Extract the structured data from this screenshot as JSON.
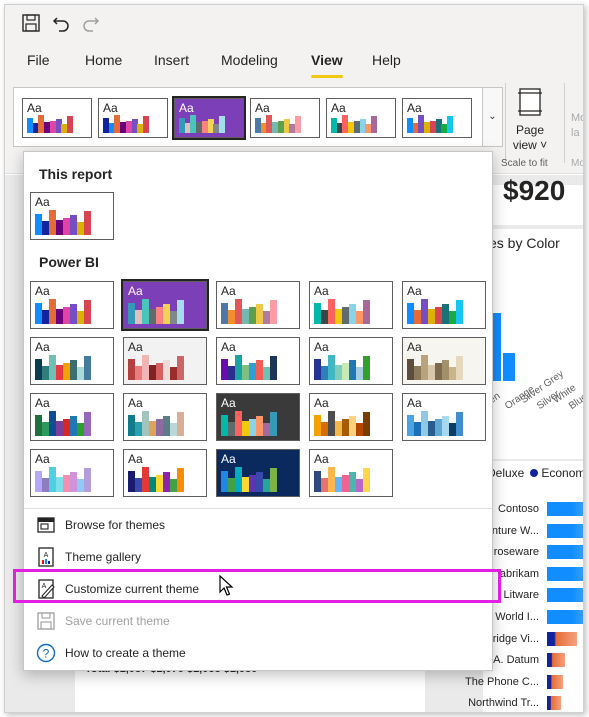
{
  "menubar": {
    "items": [
      "File",
      "Home",
      "Insert",
      "Modeling",
      "View",
      "Help"
    ],
    "active": "View"
  },
  "ribbon": {
    "page_view_label_1": "Page",
    "page_view_label_2": "view ˅",
    "scale_label": "Scale to fit",
    "cut_label_1": "Mo",
    "cut_label_2": "la",
    "cut_label_3": "Mo"
  },
  "themes": {
    "aa": "Aa",
    "this_report_title": "This report",
    "power_bi_title": "Power BI",
    "ribbon_palettes": [
      {
        "bg": "#ffffff",
        "colors": [
          "#118dff",
          "#12239e",
          "#e66c37",
          "#6b007b",
          "#e044a7",
          "#744ec2",
          "#d9b300",
          "#d64550"
        ]
      },
      {
        "bg": "#ffffff",
        "colors": [
          "#12239e",
          "#118dff",
          "#e66c37",
          "#6b007b",
          "#e044a7",
          "#744ec2",
          "#d9b300",
          "#d64550"
        ]
      },
      {
        "bg": "#7d3fb8",
        "colors": [
          "#3599b8",
          "#dfbfbf",
          "#4ac5bb",
          "#5f6b6d",
          "#fb8281",
          "#f4d25a",
          "#7f898a",
          "#a4ddee"
        ]
      },
      {
        "bg": "#ffffff",
        "colors": [
          "#4e79a7",
          "#f28e2b",
          "#e15759",
          "#76b7b2",
          "#59a14f",
          "#edc948",
          "#b07aa1",
          "#ff9da7"
        ]
      },
      {
        "bg": "#ffffff",
        "colors": [
          "#01b8aa",
          "#374649",
          "#fd625e",
          "#f2c80f",
          "#5f6b6d",
          "#8ad4eb",
          "#fe9666",
          "#a66999"
        ]
      },
      {
        "bg": "#ffffff",
        "colors": [
          "#118dff",
          "#e66c37",
          "#744ec2",
          "#d9b300",
          "#d64550",
          "#197278",
          "#1aab40",
          "#15c6f4"
        ]
      }
    ],
    "this_report": {
      "bg": "#ffffff",
      "colors": [
        "#118dff",
        "#12239e",
        "#e66c37",
        "#6b007b",
        "#e044a7",
        "#744ec2",
        "#d9b300",
        "#d64550"
      ]
    },
    "power_bi": [
      {
        "bg": "#ffffff",
        "colors": [
          "#118dff",
          "#12239e",
          "#e66c37",
          "#6b007b",
          "#e044a7",
          "#744ec2",
          "#d9b300",
          "#d64550"
        ]
      },
      {
        "bg": "#7d3fb8",
        "colors": [
          "#3599b8",
          "#dfbfbf",
          "#4ac5bb",
          "#5f6b6d",
          "#fb8281",
          "#f4d25a",
          "#7f898a",
          "#a4ddee"
        ]
      },
      {
        "bg": "#ffffff",
        "colors": [
          "#4e79a7",
          "#f28e2b",
          "#e15759",
          "#76b7b2",
          "#59a14f",
          "#edc948",
          "#b07aa1",
          "#ff9da7"
        ]
      },
      {
        "bg": "#ffffff",
        "colors": [
          "#01b8aa",
          "#374649",
          "#fd625e",
          "#f2c80f",
          "#5f6b6d",
          "#8ad4eb",
          "#fe9666",
          "#a66999"
        ]
      },
      {
        "bg": "#ffffff",
        "colors": [
          "#118dff",
          "#e66c37",
          "#744ec2",
          "#d9b300",
          "#d64550",
          "#197278",
          "#1aab40",
          "#15c6f4"
        ]
      },
      {
        "bg": "#ffffff",
        "colors": [
          "#0b3d4f",
          "#2f7e7e",
          "#70c1b3",
          "#e63946",
          "#f1a208",
          "#3c6e71",
          "#a8dadc",
          "#457b9d"
        ]
      },
      {
        "bg": "#f2f2f2",
        "colors": [
          "#b33f40",
          "#e97c7c",
          "#f2b5b5",
          "#7e2223",
          "#d65f5f",
          "#f0dada",
          "#9b2c2c",
          "#c66"
        ]
      },
      {
        "bg": "#ffffff",
        "colors": [
          "#6a0dad",
          "#2d2d8f",
          "#1aa3a3",
          "#7fbf7f",
          "#2b9fd6",
          "#f25c54",
          "#70c1b3",
          "#1d3557"
        ]
      },
      {
        "bg": "#ffffff",
        "colors": [
          "#253494",
          "#2c7fb8",
          "#41b6c4",
          "#7fcdbb",
          "#c7e9b4",
          "#1f78b4",
          "#a6cee3",
          "#33a02c"
        ]
      },
      {
        "bg": "#f7f5ef",
        "colors": [
          "#5c4d3c",
          "#8c7a5b",
          "#b9a37e",
          "#d9c8a9",
          "#7d6b4f",
          "#a38f6a",
          "#c9b48c",
          "#e6d8bd"
        ]
      },
      {
        "bg": "#ffffff",
        "colors": [
          "#1f6f3f",
          "#2c9a5a",
          "#0e4d92",
          "#7a3e9d",
          "#d62728",
          "#1f77b4",
          "#2ca02c",
          "#9467bd"
        ]
      },
      {
        "bg": "#ffffff",
        "colors": [
          "#117a8b",
          "#28a0b0",
          "#a3c4bc",
          "#e0a458",
          "#8d6a9f",
          "#5c7c8a",
          "#b8d8d8",
          "#d9ae94"
        ]
      },
      {
        "bg": "#3a3a3a",
        "colors": [
          "#01b8aa",
          "#5f6b6d",
          "#fd625e",
          "#f2c80f",
          "#8ad4eb",
          "#fe9666",
          "#a66999",
          "#3599b8"
        ]
      },
      {
        "bg": "#ffffff",
        "colors": [
          "#f4a300",
          "#d96c00",
          "#4d4d4d",
          "#f2b84b",
          "#a65d00",
          "#ffd27f",
          "#b34700",
          "#7a3d00"
        ]
      },
      {
        "bg": "#ffffff",
        "colors": [
          "#4ba3e3",
          "#1d6fb8",
          "#8ecae6",
          "#2a5d8f",
          "#5fa8d3",
          "#a8d8f0",
          "#0d3b66",
          "#3e8ed0"
        ]
      },
      {
        "bg": "#ffffff",
        "colors": [
          "#b4a7f5",
          "#8e7cc3",
          "#4dd0e1",
          "#80deea",
          "#f48fb1",
          "#ce93d8",
          "#90caf9",
          "#b39ddb"
        ]
      },
      {
        "bg": "#ffffff",
        "colors": [
          "#1a1a6e",
          "#3949ab",
          "#e53935",
          "#00897b",
          "#fdd835",
          "#8e24aa",
          "#43a047",
          "#fb8c00"
        ]
      },
      {
        "bg": "#0a2a5e",
        "colors": [
          "#1e88e5",
          "#43a047",
          "#00acc1",
          "#fdd835",
          "#5e35b1",
          "#3949ab",
          "#26a69a",
          "#7cb342"
        ]
      },
      {
        "bg": "#ffffff",
        "colors": [
          "#2e4a7d",
          "#e57373",
          "#ffb74d",
          "#64b5f6",
          "#f06292",
          "#4db6ac",
          "#ba68c8",
          "#ffd54f"
        ]
      }
    ]
  },
  "menu": {
    "browse": "Browse for themes",
    "gallery": "Theme gallery",
    "customize": "Customize current theme",
    "save": "Save current theme",
    "howto": "How to create a theme"
  },
  "report": {
    "kpi": "$920",
    "chart_title": "es by Color",
    "x_labels": [
      "en",
      "Orange",
      "Silver Grey",
      "Silver",
      "White",
      "Blue"
    ],
    "legend_deluxe": "Deluxe",
    "legend_economy": "Economy",
    "stores": [
      "Contoso",
      "enture W...",
      "Proseware",
      "abrikam",
      "Litware",
      "e World I...",
      "hridge Vi...",
      "A. Datum",
      "The Phone C...",
      "Northwind Tr..."
    ],
    "total_row": "Total         $1,037      $1,070      $1,033      $1,030"
  }
}
